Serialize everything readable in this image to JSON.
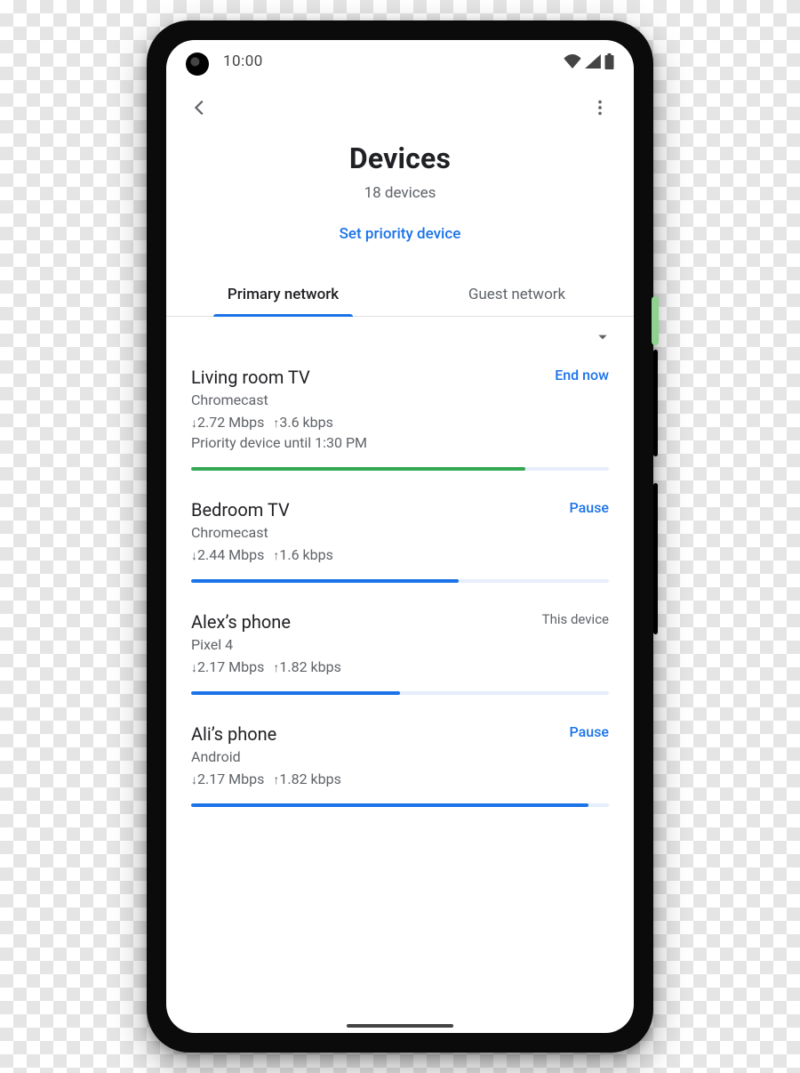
{
  "status": {
    "time": "10:00"
  },
  "header": {
    "title": "Devices",
    "subtitle": "18  devices",
    "priority_link": "Set priority device"
  },
  "tabs": {
    "primary": "Primary network",
    "guest": "Guest network",
    "active": "primary"
  },
  "devices": [
    {
      "name": "Living room TV",
      "type": "Chromecast",
      "down": "2.72 Mbps",
      "up": "3.6 kbps",
      "note": "Priority device until 1:30 PM",
      "action_label": "End now",
      "action_kind": "link",
      "bar_pct": 80,
      "bar_color": "green"
    },
    {
      "name": "Bedroom TV",
      "type": "Chromecast",
      "down": "2.44 Mbps",
      "up": "1.6 kbps",
      "action_label": "Pause",
      "action_kind": "link",
      "bar_pct": 64,
      "bar_color": "blue"
    },
    {
      "name": "Alex’s phone",
      "type": "Pixel 4",
      "down": "2.17 Mbps",
      "up": "1.82 kbps",
      "action_label": "This device",
      "action_kind": "muted",
      "bar_pct": 50,
      "bar_color": "blue"
    },
    {
      "name": "Ali’s phone",
      "type": "Android",
      "down": "2.17 Mbps",
      "up": "1.82 kbps",
      "action_label": "Pause",
      "action_kind": "link",
      "bar_pct": 95,
      "bar_color": "blue"
    }
  ]
}
